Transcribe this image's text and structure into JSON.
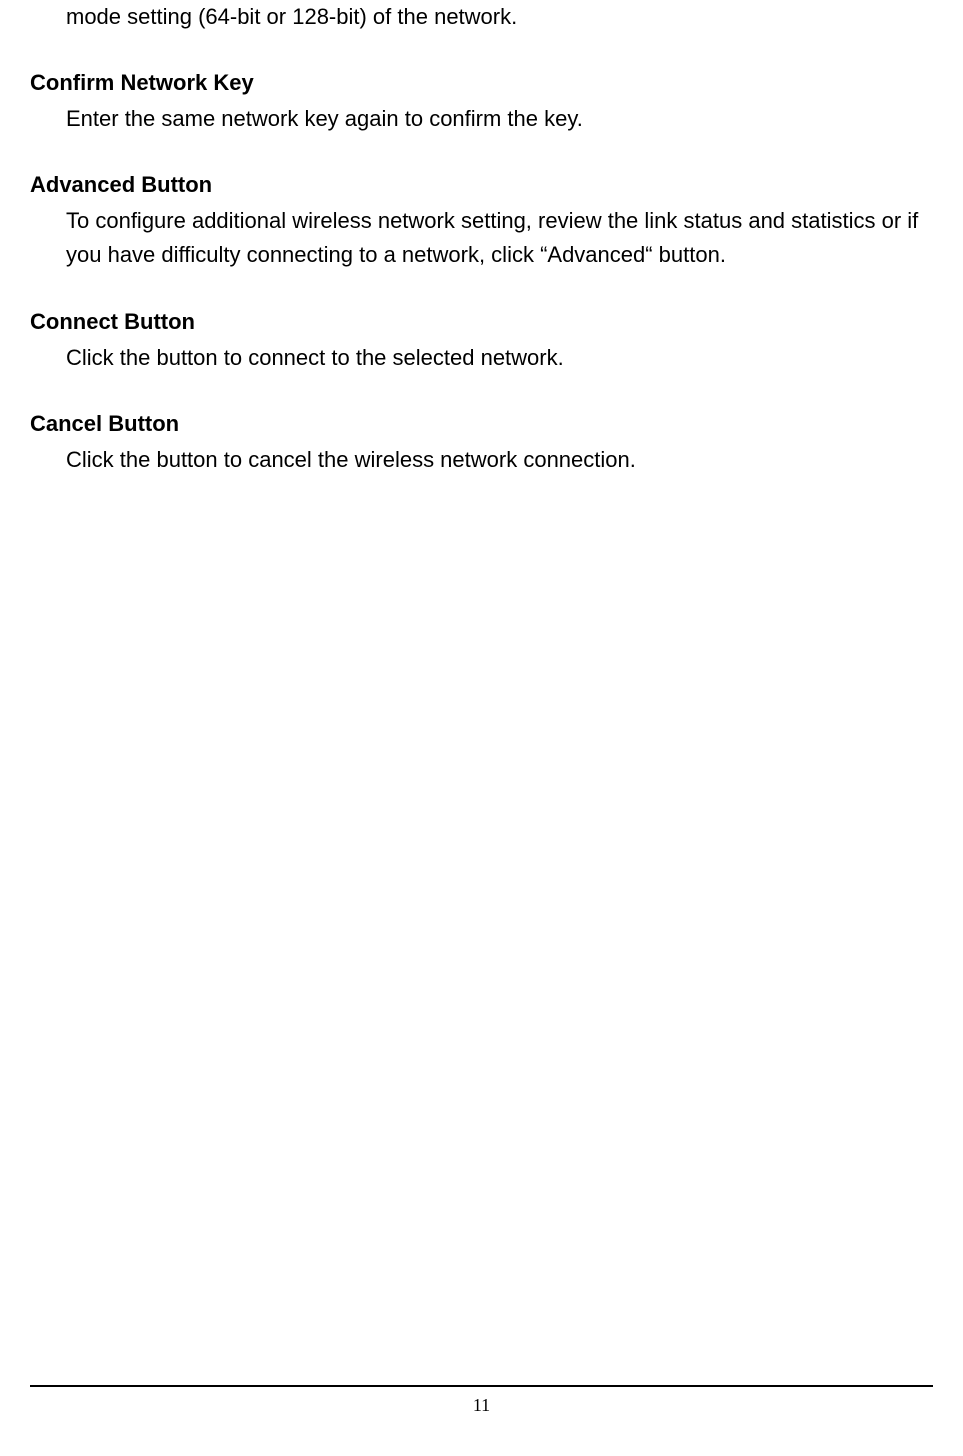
{
  "fragment_text": "mode setting (64-bit or 128-bit) of the network.",
  "sections": {
    "confirm": {
      "heading": "Confirm Network Key",
      "body": "Enter the same network key again to confirm the key."
    },
    "advanced": {
      "heading": "Advanced Button",
      "body": "To configure additional wireless network setting, review the link status and statistics or if you have difficulty connecting to a network, click “Advanced“ button."
    },
    "connect": {
      "heading": "Connect Button",
      "body": "Click the button to connect to the selected network."
    },
    "cancel": {
      "heading": "Cancel Button",
      "body": "Click the button to cancel the wireless network connection."
    }
  },
  "page_number": "11"
}
